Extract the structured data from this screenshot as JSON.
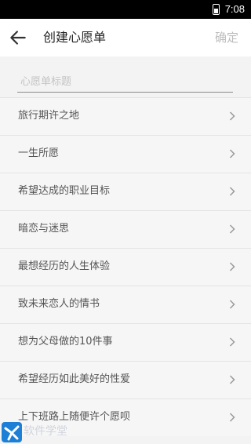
{
  "status_bar": {
    "time": "7:08",
    "icon": "battery-icon"
  },
  "header": {
    "back_icon": "arrow-left-icon",
    "title": "创建心愿单",
    "confirm_label": "确定"
  },
  "title_input": {
    "placeholder": "心愿单标题",
    "value": ""
  },
  "wish_list": [
    {
      "label": "旅行期许之地"
    },
    {
      "label": "一生所愿"
    },
    {
      "label": "希望达成的职业目标"
    },
    {
      "label": "暗恋与迷思"
    },
    {
      "label": "最想经历的人生体验"
    },
    {
      "label": "致未来恋人的情书"
    },
    {
      "label": "想为父母做的10件事"
    },
    {
      "label": "希望经历如此美好的性爱"
    },
    {
      "label": "上下班路上随便许个愿呗"
    }
  ],
  "watermark": {
    "text": "软件学堂"
  },
  "colors": {
    "accent_text": "#222222",
    "disabled_text": "#bcbcbc",
    "background": "#f3f3f3"
  }
}
